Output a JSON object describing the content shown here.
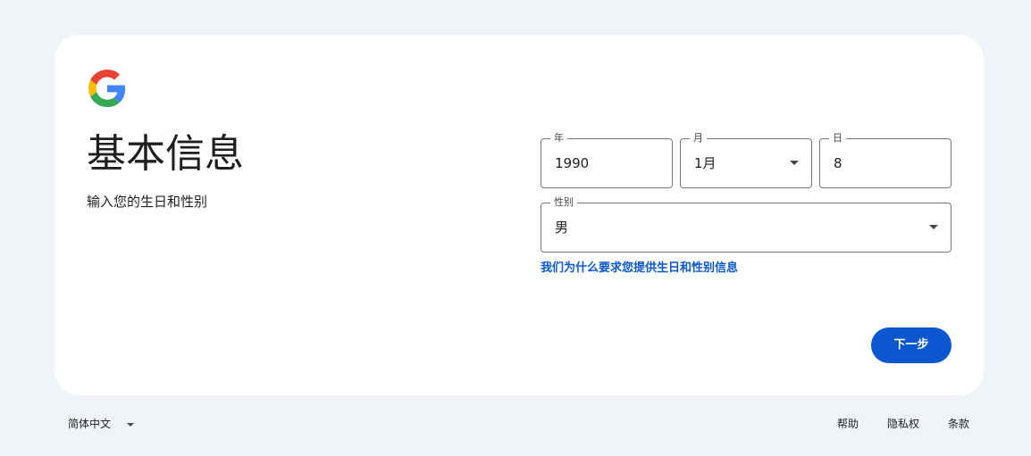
{
  "header": {
    "title": "基本信息",
    "subtitle": "输入您的生日和性别",
    "logo_icon": "google-g-icon"
  },
  "form": {
    "year": {
      "label": "年",
      "value": "1990"
    },
    "month": {
      "label": "月",
      "value": "1月"
    },
    "day": {
      "label": "日",
      "value": "8"
    },
    "gender": {
      "label": "性别",
      "value": "男"
    },
    "why_link": "我们为什么要求您提供生日和性别信息",
    "next_button": "下一步"
  },
  "footer": {
    "language": "简体中文",
    "help": "帮助",
    "privacy": "隐私权",
    "terms": "条款"
  },
  "colors": {
    "background": "#f0f4f9",
    "card": "#ffffff",
    "accent": "#0b57d0",
    "text": "#1f1f1f"
  }
}
